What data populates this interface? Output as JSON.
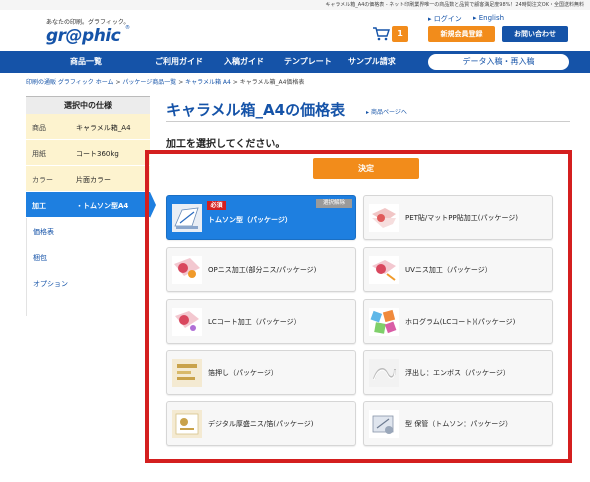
{
  "topbar": {
    "text": "キャラメル箱_A4の価格表 - ネット印刷業界唯一の商品数と品質で顧客満足度98%！24時間注文OK・全国送料無料"
  },
  "header": {
    "tagline": "あなたの印刷。グラフィック。",
    "logo": "gr@phic",
    "logo_mark": "®",
    "login_label": "ログイン",
    "english_label": "English",
    "cart_count": "1",
    "register_label": "新規会員登録",
    "contact_label": "お問い合わせ"
  },
  "nav": {
    "items": [
      "商品一覧",
      "ご利用ガイド",
      "入稿ガイド",
      "テンプレート",
      "サンプル請求"
    ],
    "data_upload_label": "データ入稿・再入稿"
  },
  "breadcrumb": {
    "items": [
      "印刷の通販 グラフィック ホーム",
      "パッケージ商品一覧",
      "キャラメル箱 A4",
      "キャラメル箱_A4価格表"
    ],
    "separator": ">"
  },
  "sidebar": {
    "title": "選択中の仕様",
    "specs": [
      {
        "key": "商品",
        "value": "キャラメル箱_A4"
      },
      {
        "key": "用紙",
        "value": "コート360kg"
      },
      {
        "key": "カラー",
        "value": "片面カラー"
      },
      {
        "key": "加工",
        "value": "・トムソン型A4"
      }
    ],
    "links": [
      "価格表",
      "梱包",
      "オプション"
    ]
  },
  "main": {
    "title": "キャラメル箱_A4の価格表",
    "product_page_link": "商品ページへ",
    "subhead": "加工を選択してください。",
    "decide_label": "決定",
    "required_badge": "必須",
    "clear_badge": "選択解除",
    "options": [
      {
        "label": "トムソン型（パッケージ）",
        "selected": true,
        "icon": "die-cut-icon"
      },
      {
        "label": "PET貼/マットPP貼加工(パッケージ)",
        "selected": false,
        "icon": "lamination-icon"
      },
      {
        "label": "OPニス加工(部分ニス/パッケージ)",
        "selected": false,
        "icon": "op-varnish-icon"
      },
      {
        "label": "UVニス加工（パッケージ）",
        "selected": false,
        "icon": "uv-varnish-icon"
      },
      {
        "label": "LCコート加工（パッケージ）",
        "selected": false,
        "icon": "lc-coat-icon"
      },
      {
        "label": "ホログラム(LCコート)(パッケージ)",
        "selected": false,
        "icon": "hologram-icon"
      },
      {
        "label": "箔押し（パッケージ）",
        "selected": false,
        "icon": "foil-stamp-icon"
      },
      {
        "label": "浮出し：エンボス（パッケージ）",
        "selected": false,
        "icon": "emboss-icon"
      },
      {
        "label": "デジタル厚盛ニス/箔(パッケージ)",
        "selected": false,
        "icon": "digital-varnish-icon"
      },
      {
        "label": "型 保管（トムソン：パッケージ）",
        "selected": false,
        "icon": "die-storage-icon"
      }
    ]
  },
  "colors": {
    "brand_blue": "#1553a8",
    "active_blue": "#1e7fe0",
    "accent_orange": "#f28c1b",
    "highlight_red": "#d41f1f",
    "spec_yellow": "#fdf3cf"
  }
}
